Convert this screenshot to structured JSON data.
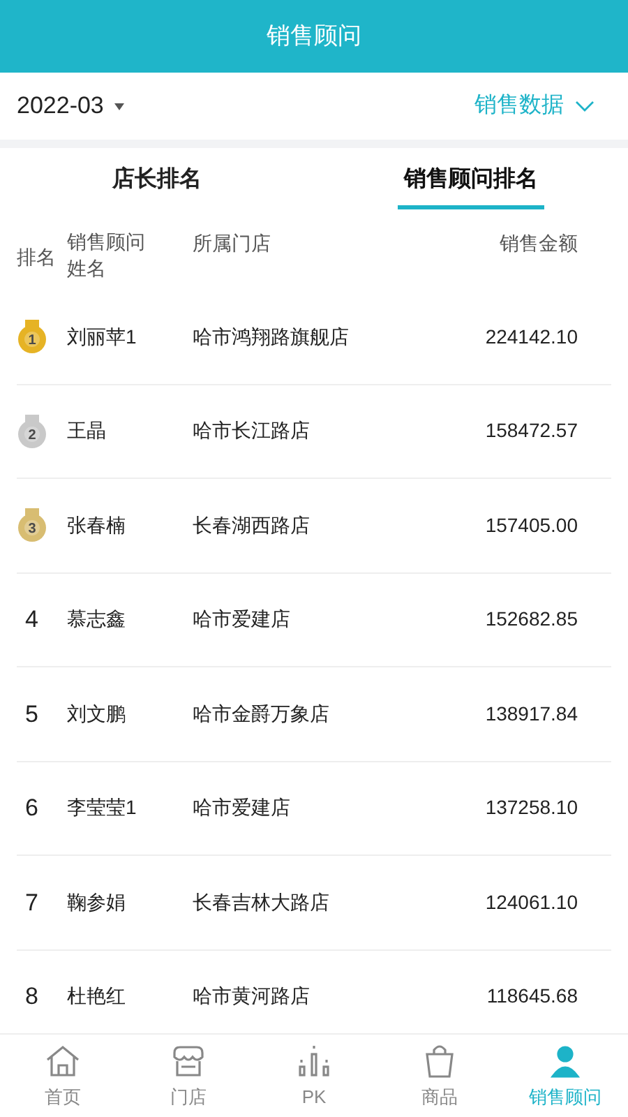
{
  "header": {
    "title": "销售顾问"
  },
  "filter": {
    "month": "2022-03",
    "category": "销售数据"
  },
  "tabs": [
    {
      "label": "店长排名",
      "selected": false
    },
    {
      "label": "销售顾问排名",
      "selected": true
    }
  ],
  "table": {
    "columns": [
      "排名",
      "销售顾问姓名",
      "所属门店",
      "销售金额"
    ],
    "rows": [
      {
        "kind": "medal",
        "rank": "1",
        "color": "#e6b325",
        "name": "刘丽苹1",
        "store": "哈市鸿翔路旗舰店",
        "amount": "224142.10"
      },
      {
        "kind": "medal",
        "rank": "2",
        "color": "#c9c9c9",
        "name": "王晶",
        "store": "哈市长江路店",
        "amount": "158472.57"
      },
      {
        "kind": "medal",
        "rank": "3",
        "color": "#d8bd72",
        "name": "张春楠",
        "store": "长春湖西路店",
        "amount": "157405.00"
      },
      {
        "kind": "number",
        "rank": "4",
        "name": "慕志鑫",
        "store": "哈市爱建店",
        "amount": "152682.85"
      },
      {
        "kind": "number",
        "rank": "5",
        "name": "刘文鹏",
        "store": "哈市金爵万象店",
        "amount": "138917.84"
      },
      {
        "kind": "number",
        "rank": "6",
        "name": "李莹莹1",
        "store": "哈市爱建店",
        "amount": "137258.10"
      },
      {
        "kind": "number",
        "rank": "7",
        "name": "鞠参娟",
        "store": "长春吉林大路店",
        "amount": "124061.10"
      },
      {
        "kind": "number",
        "rank": "8",
        "name": "杜艳红",
        "store": "哈市黄河路店",
        "amount": "118645.68"
      }
    ]
  },
  "nav": [
    {
      "kind": "home",
      "label": "首页",
      "selected": false
    },
    {
      "kind": "store",
      "label": "门店",
      "selected": false
    },
    {
      "kind": "pk",
      "label": "PK",
      "selected": false
    },
    {
      "kind": "goods",
      "label": "商品",
      "selected": false
    },
    {
      "kind": "advisor",
      "label": "销售顾问",
      "selected": true
    }
  ]
}
